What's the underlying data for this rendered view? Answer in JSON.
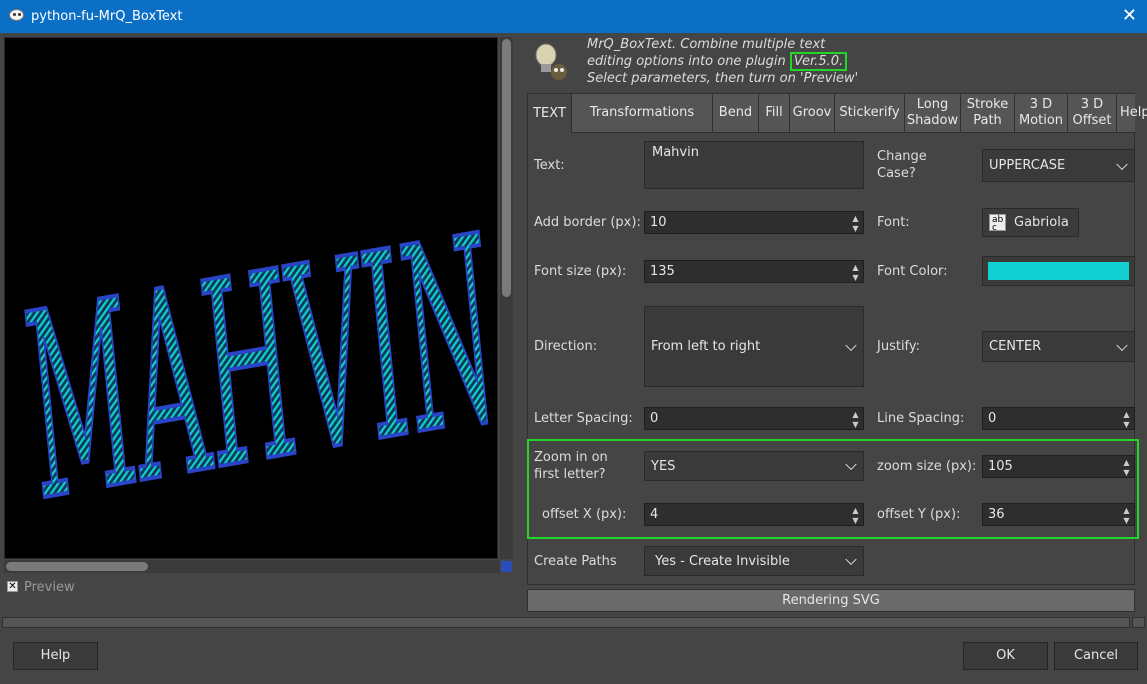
{
  "window": {
    "title": "python-fu-MrQ_BoxText",
    "close_glyph": "✕"
  },
  "preview": {
    "artwork_text": "MAHVIN",
    "checkbox_glyph": "✕",
    "checkbox_label": "Preview",
    "checked": true
  },
  "info": {
    "line1": "MrQ_BoxText. Combine multiple text",
    "line2": "editing options into one plugin ",
    "version": "Ver.5.0.",
    "line3": "Select parameters, then turn on 'Preview'"
  },
  "tabs": [
    {
      "label": "TEXT"
    },
    {
      "label": "Transformations"
    },
    {
      "label": "Bend"
    },
    {
      "label": "Fill"
    },
    {
      "label": "Groov"
    },
    {
      "label": "Stickerify"
    },
    {
      "label": "Long\nShadow"
    },
    {
      "label": "Stroke\nPath"
    },
    {
      "label": "3 D\nMotion"
    },
    {
      "label": "3 D\nOffset"
    },
    {
      "label": "Help"
    }
  ],
  "form": {
    "text_label": "Text:",
    "text_value": "Mahvin",
    "change_case_label": "Change\nCase?",
    "change_case_value": "UPPERCASE",
    "border_label": "Add border (px):",
    "border_value": "10",
    "font_label": "Font:",
    "font_value": "Gabriola",
    "font_icon_glyph": "ab\nc",
    "fontsize_label": "Font size (px):",
    "fontsize_value": "135",
    "fontcolor_label": "Font Color:",
    "fontcolor_value": "#12cfd2",
    "direction_label": "Direction:",
    "direction_value": "From left to right",
    "justify_label": "Justify:",
    "justify_value": "CENTER",
    "letter_spacing_label": "Letter Spacing:",
    "letter_spacing_value": "0",
    "line_spacing_label": "Line Spacing:",
    "line_spacing_value": "0",
    "zoom_label": "Zoom in on\nfirst letter?",
    "zoom_value": "YES",
    "zoom_size_label": "zoom size (px):",
    "zoom_size_value": "105",
    "offset_x_label": "offset X (px):",
    "offset_x_value": "4",
    "offset_y_label": "offset Y (px):",
    "offset_y_value": "36",
    "paths_label": "Create Paths",
    "paths_value": "Yes - Create Invisible"
  },
  "progress": {
    "text": "Rendering SVG"
  },
  "spinner": {
    "up": "▲",
    "down": "▼"
  },
  "buttons": {
    "help": "Help",
    "ok": "OK",
    "cancel": "Cancel"
  },
  "colors": {
    "highlight": "#25d428",
    "text_fill": "#12cfd2",
    "text_outline": "#2a44c8",
    "titlebar": "#0b6fc6"
  }
}
